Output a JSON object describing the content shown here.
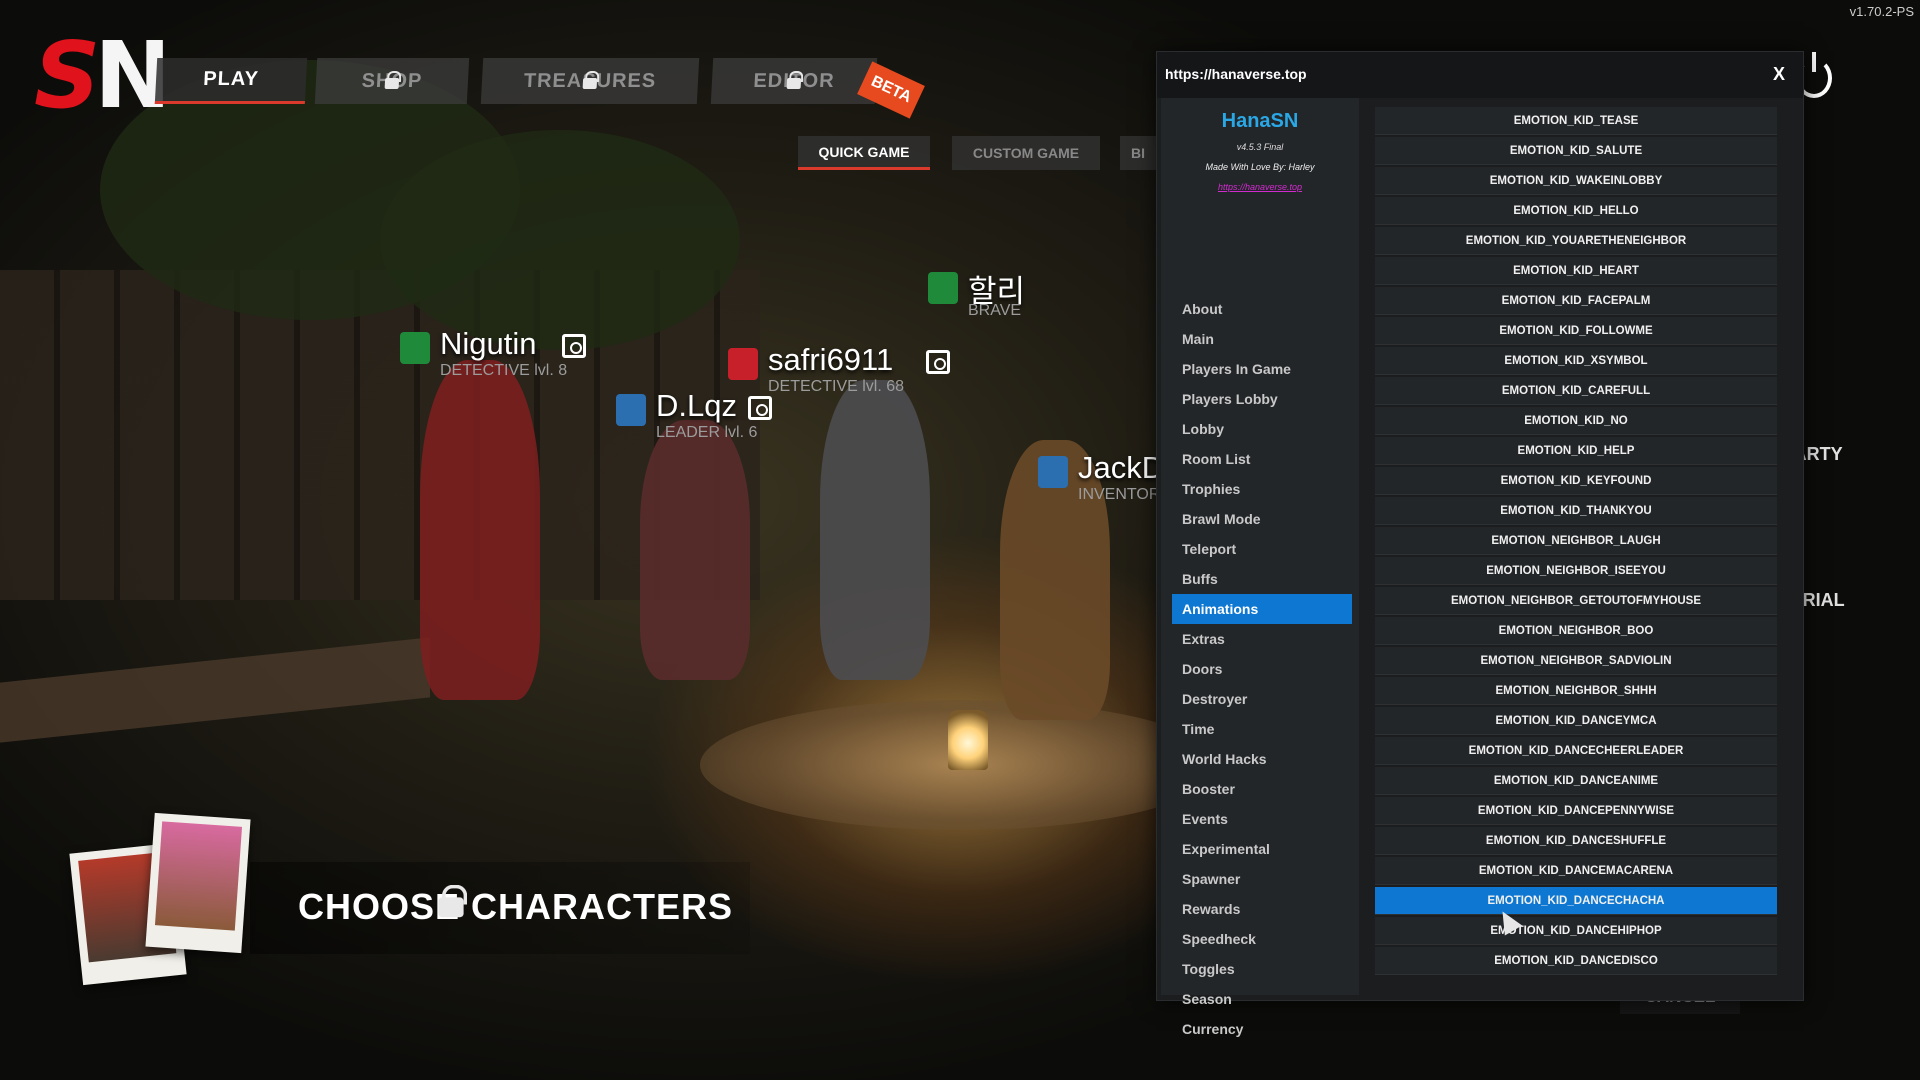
{
  "version": "v1.70.2-PS",
  "logo": {
    "s": "S",
    "n": "N"
  },
  "nav": {
    "tabs": [
      {
        "label": "PLAY",
        "locked": false
      },
      {
        "label": "SHOP",
        "locked": true
      },
      {
        "label": "TREASURES",
        "locked": true
      },
      {
        "label": "EDITOR",
        "locked": true
      }
    ],
    "beta": "BETA"
  },
  "subnav": {
    "tabs": [
      "QUICK GAME",
      "CUSTOM GAME",
      "BI"
    ]
  },
  "players": [
    {
      "name": "Nigutin",
      "rank": "DETECTIVE lvl. 8",
      "color": "#1e8a3a"
    },
    {
      "name": "safri6911",
      "rank": "DETECTIVE lvl. 68",
      "color": "#c8202a"
    },
    {
      "name": "D.Lqz",
      "rank": "LEADER lvl. 6",
      "color": "#2c6fb0"
    },
    {
      "name": "할리",
      "rank": "BRAVE",
      "color": "#1e8a3a"
    },
    {
      "name": "JackD",
      "rank": "INVENTOR",
      "color": "#2c6fb0"
    }
  ],
  "choose_characters": "CHOOSE CHARACTERS",
  "side_buttons": {
    "party": "ND PARTY",
    "tutorial": "TORIAL",
    "cancel": "CANCEL"
  },
  "overlay": {
    "url": "https://hanaverse.top",
    "close": "X",
    "brand": "HanaSN",
    "brand_version": "v4.5.3 Final",
    "brand_credit": "Made With Love By: Harley",
    "brand_link": "https://hanaverse.top",
    "accent": "#0e77d1",
    "menu": [
      "About",
      "Main",
      "Players In Game",
      "Players Lobby",
      "Lobby",
      "Room List",
      "Trophies",
      "Brawl Mode",
      "Teleport",
      "Buffs",
      "Animations",
      "Extras",
      "Doors",
      "Destroyer",
      "Time",
      "World Hacks",
      "Booster",
      "Events",
      "Experimental",
      "Spawner",
      "Rewards",
      "Speedheck",
      "Toggles",
      "Season",
      "Currency"
    ],
    "active_menu": "Animations",
    "animations": [
      "EMOTION_KID_TEASE",
      "EMOTION_KID_SALUTE",
      "EMOTION_KID_WAKEINLOBBY",
      "EMOTION_KID_HELLO",
      "EMOTION_KID_YOUARETHENEIGHBOR",
      "EMOTION_KID_HEART",
      "EMOTION_KID_FACEPALM",
      "EMOTION_KID_FOLLOWME",
      "EMOTION_KID_XSYMBOL",
      "EMOTION_KID_CAREFULL",
      "EMOTION_KID_NO",
      "EMOTION_KID_HELP",
      "EMOTION_KID_KEYFOUND",
      "EMOTION_KID_THANKYOU",
      "EMOTION_NEIGHBOR_LAUGH",
      "EMOTION_NEIGHBOR_ISEEYOU",
      "EMOTION_NEIGHBOR_GETOUTOFMYHOUSE",
      "EMOTION_NEIGHBOR_BOO",
      "EMOTION_NEIGHBOR_SADVIOLIN",
      "EMOTION_NEIGHBOR_SHHH",
      "EMOTION_KID_DANCEYMCA",
      "EMOTION_KID_DANCECHEERLEADER",
      "EMOTION_KID_DANCEANIME",
      "EMOTION_KID_DANCEPENNYWISE",
      "EMOTION_KID_DANCESHUFFLE",
      "EMOTION_KID_DANCEMACARENA",
      "EMOTION_KID_DANCECHACHA",
      "EMOTION_KID_DANCEHIPHOP",
      "EMOTION_KID_DANCEDISCO"
    ],
    "active_animation": "EMOTION_KID_DANCECHACHA"
  }
}
